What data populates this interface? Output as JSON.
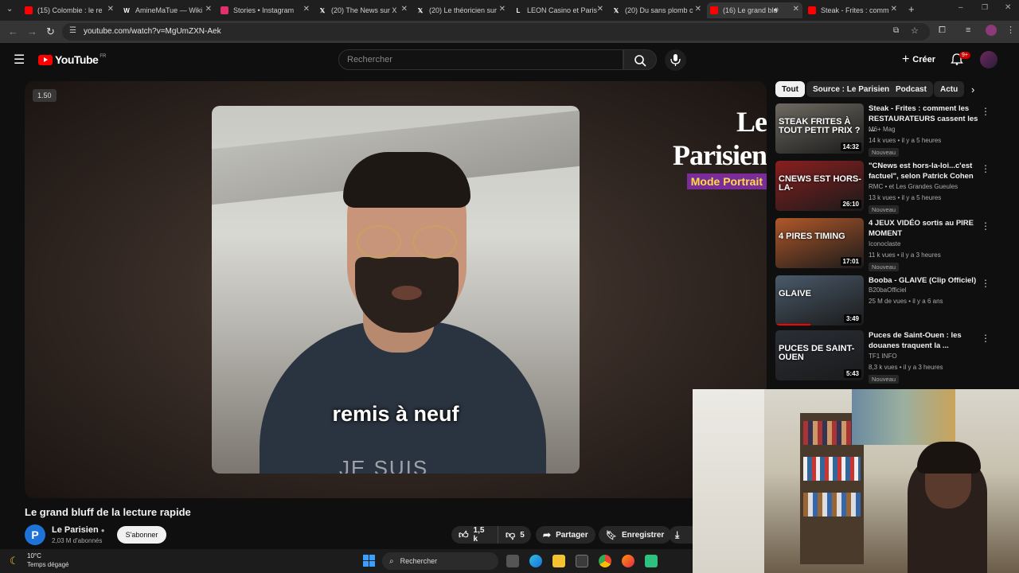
{
  "browser": {
    "tabs": [
      {
        "title": "(15) Colombie : le re",
        "icon": "youtube-icon",
        "color": "#ff0000"
      },
      {
        "title": "AmineMaTue — Wiki",
        "icon": "wikipedia-icon",
        "color": "#ffffff"
      },
      {
        "title": "Stories • Instagram",
        "icon": "instagram-icon",
        "color": "#e1306c"
      },
      {
        "title": "(20) The News sur X",
        "icon": "x-icon",
        "color": "#ffffff"
      },
      {
        "title": "(20) Le théoricien sur",
        "icon": "x-icon",
        "color": "#ffffff"
      },
      {
        "title": "LEON Casino et Paris",
        "icon": "leon-icon",
        "color": "#ffffff"
      },
      {
        "title": "(20) Du sans plomb c",
        "icon": "x-icon",
        "color": "#ffffff"
      },
      {
        "title": "(16) Le grand blu",
        "icon": "youtube-icon",
        "color": "#ff0000"
      },
      {
        "title": "Steak - Frites : comm",
        "icon": "youtube-icon",
        "color": "#ff0000"
      }
    ],
    "url": "youtube.com/watch?v=MgUmZXN-Aek"
  },
  "header": {
    "logo": "YouTube",
    "region": "FR",
    "search_placeholder": "Rechercher",
    "create_label": "Créer",
    "notifications_badge": "9+"
  },
  "player": {
    "speed": "1.50",
    "caption": "remis à neuf",
    "shirt_text": "JE SUIS",
    "brand_name": "Le Parisien",
    "brand_badge": "Mode Portrait"
  },
  "video": {
    "title": "Le grand bluff de la lecture rapide",
    "channel": "Le Parisien",
    "channel_initial": "P",
    "subscribers": "2,03 M d'abonnés",
    "subscribe_label": "S'abonner",
    "likes": "1,5 k",
    "dislikes": "5",
    "share_label": "Partager",
    "save_label": "Enregistrer"
  },
  "sidebar": {
    "chips": [
      "Tout",
      "Source : Le Parisien",
      "Podcast",
      "Actu"
    ],
    "recommendations": [
      {
        "title": "Steak - Frites : comment les RESTAURATEURS cassent les ...",
        "channel": "M6+ Mag",
        "meta": "14 k vues • il y a 5 heures",
        "badge": "Nouveau",
        "duration": "14:32",
        "thumb_text": "STEAK FRITES À TOUT PETIT PRIX ?",
        "thumb_color": "#6e6a62"
      },
      {
        "title": "\"CNews est hors-la-loi...c'est factuel\", selon Patrick Cohen",
        "channel": "RMC • et Les Grandes Gueules",
        "meta": "13 k vues • il y a 5 heures",
        "badge": "Nouveau",
        "duration": "26:10",
        "thumb_text": "CNEWS EST HORS-LA-",
        "thumb_color": "#8a1f1f"
      },
      {
        "title": "4 JEUX VIDÉO sortis au PIRE MOMENT",
        "channel": "Iconoclaste",
        "meta": "11 k vues • il y a 3 heures",
        "badge": "Nouveau",
        "duration": "17:01",
        "thumb_text": "4 PIRES TIMING",
        "thumb_color": "#b0582a"
      },
      {
        "title": "Booba - GLAIVE (Clip Officiel)",
        "channel": "B20baOfficiel",
        "meta": "25 M de vues • il y a 6 ans",
        "badge": "",
        "duration": "3:49",
        "thumb_text": "GLAIVE",
        "thumb_color": "#4a5a6a"
      },
      {
        "title": "Puces de Saint-Ouen : les douanes traquent la ...",
        "channel": "TF1 INFO",
        "meta": "8,3 k vues • il y a 3 heures",
        "badge": "Nouveau",
        "duration": "5:43",
        "thumb_text": "PUCES DE SAINT-OUEN",
        "thumb_color": "#2a2e36"
      }
    ]
  },
  "taskbar": {
    "temperature": "10°C",
    "weather": "Temps dégagé",
    "search_label": "Rechercher"
  }
}
